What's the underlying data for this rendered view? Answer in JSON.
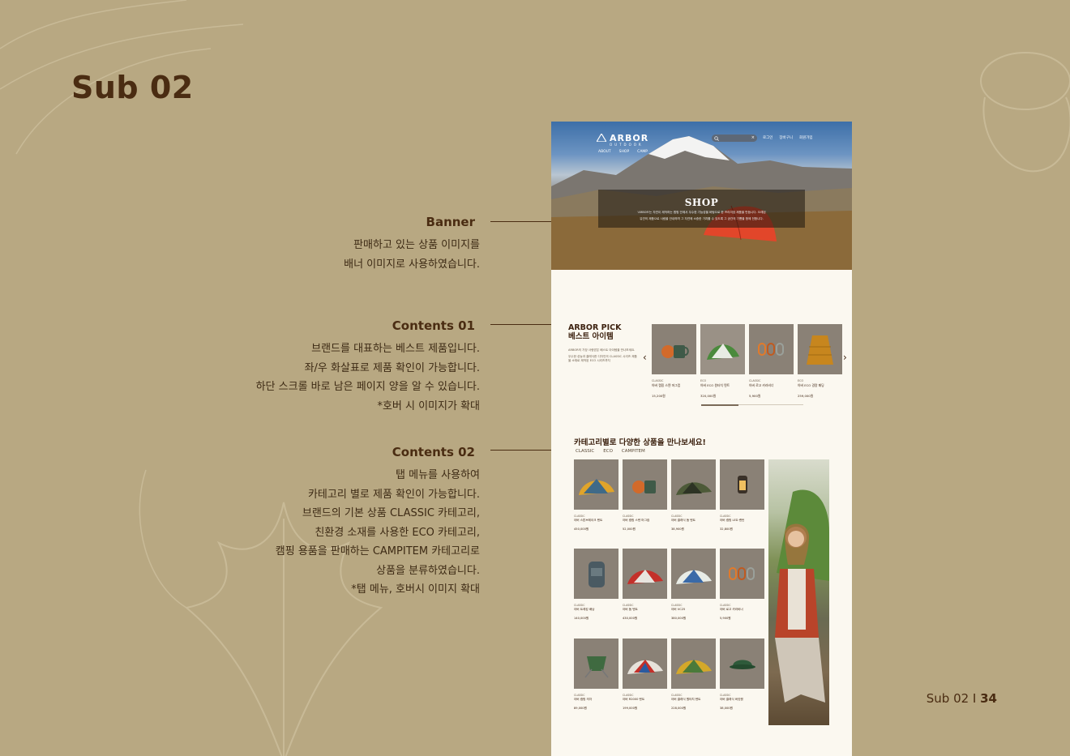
{
  "page": {
    "title": "Sub 02",
    "footer_section": "Sub 02 I ",
    "footer_page": "34"
  },
  "annotations": [
    {
      "title": "Banner",
      "lines": [
        "판매하고 있는 상품 이미지를",
        "배너 이미지로 사용하였습니다."
      ]
    },
    {
      "title": "Contents 01",
      "lines": [
        "브랜드를 대표하는 베스트 제품입니다.",
        "좌/우 화살표로 제품 확인이 가능합니다.",
        "하단 스크롤 바로 남은 페이지 양을 알 수 있습니다.",
        "*호버 시 이미지가 확대"
      ]
    },
    {
      "title": "Contents 02",
      "lines": [
        "탭 메뉴를  사용하여",
        "카테고리 별로 제품 확인이 가능합니다.",
        "브랜드의 기본 상품 CLASSIC 카테고리,",
        "친환경 소재를 사용한 ECO 카테고리,",
        "캠핑 용품을 판매하는 CAMPITEM 카테고리로",
        "상품을 분류하였습니다.",
        "*탭 메뉴, 호버시 이미지 확대"
      ]
    }
  ],
  "mockup": {
    "logo": "ARBOR",
    "logo_sub": "OUTDOOR",
    "util_nav": [
      "로그인",
      "장바구니",
      "회원가입"
    ],
    "gnb": [
      "ABOUT",
      "SHOP",
      "CAMP"
    ],
    "banner_title": "SHOP",
    "banner_desc": [
      "'ARBOR'는 자연이 제작하는 맵핑 안에서 우수한 기능성을 바탕으로 한 프리미엄 제품을 만듭니다. 오래된",
      "유연의 제품으로 사람을 안내하며 그 자연에 소중한 가치를 수 있도록 그 공간의 기쁨을 함께 전합니다."
    ],
    "pick_title": [
      "ARBOR PICK",
      "베스트 아이템"
    ],
    "pick_desc": [
      "ARBOR의 가장 사랑받은 베스트 아이템을 만나보세요.",
      "우수한 성능과 클래식한 디자인의 CLASSIC 시리즈 제품을 소재로 제작된 ECO 시리즈까지"
    ],
    "arrow_prev": "‹",
    "arrow_next": "›",
    "best_items": [
      {
        "category": "CLASSIC",
        "name": "아버 캠핑 스텐 머그컵",
        "price": "15,200원"
      },
      {
        "category": "ECO",
        "name": "아버 ECO 원터치 텐트",
        "price": "320,000원"
      },
      {
        "category": "CLASSIC",
        "name": "아버 로고 카라비너",
        "price": "5,900원"
      },
      {
        "category": "ECO",
        "name": "아버 ECO 경량 패딩",
        "price": "259,000원"
      }
    ],
    "category_title": "카테고리별로 다양한 상품을 만나보세요!",
    "tabs": [
      "CLASSIC",
      "ECO",
      "CAMPITEM"
    ],
    "grid_items": [
      {
        "category": "CLASSIC",
        "name": "아버 스톤브레이크 텐트",
        "price": "450,000원"
      },
      {
        "category": "CLASSIC",
        "name": "아버 캠핑 스텐 머그컵",
        "price": "52,000원"
      },
      {
        "category": "CLASSIC",
        "name": "아버 클래식 돔 텐트",
        "price": "38,900원"
      },
      {
        "category": "CLASSIC",
        "name": "아버 캠핑 LED 랜턴",
        "price": "32,800원"
      },
      {
        "category": "CLASSIC",
        "name": "아버 트레킹 배낭",
        "price": "140,000원"
      },
      {
        "category": "CLASSIC",
        "name": "아버 돔 텐트",
        "price": "430,000원"
      },
      {
        "category": "CLASSIC",
        "name": "아버 VC25",
        "price": "380,000원"
      },
      {
        "category": "CLASSIC",
        "name": "아버 로고 카라비너",
        "price": "5,900원"
      },
      {
        "category": "CLASSIC",
        "name": "아버 캠핑 의자",
        "price": "89,000원"
      },
      {
        "category": "CLASSIC",
        "name": "아버 R2000 텐트",
        "price": "199,000원"
      },
      {
        "category": "CLASSIC",
        "name": "아버 클래식 원터치 텐트",
        "price": "228,000원"
      },
      {
        "category": "CLASSIC",
        "name": "아버 클래식 버킷햇",
        "price": "38,000원"
      }
    ]
  }
}
